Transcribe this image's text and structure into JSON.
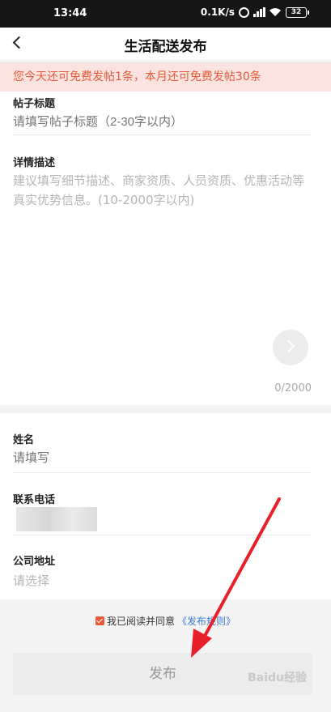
{
  "status": {
    "time": "13:44",
    "speed": "0.1K/s",
    "battery": "32"
  },
  "header": {
    "title": "生活配送发布"
  },
  "notice": "您今天还可免费发帖1条，本月还可免费发帖30条",
  "form": {
    "post_title": {
      "label": "帖子标题",
      "placeholder": "请填写帖子标题（2-30字以内）"
    },
    "description": {
      "label": "详情描述",
      "placeholder": "建议填写细节描述、商家资质、人员资质、优惠活动等真实优势信息。(10-2000字以内)",
      "counter": "0/2000"
    },
    "name": {
      "label": "姓名",
      "placeholder": "请填写"
    },
    "phone": {
      "label": "联系电话"
    },
    "address": {
      "label": "公司地址",
      "placeholder": "请选择"
    }
  },
  "agreement": {
    "text": "我已阅读并同意",
    "link": "《发布规则》",
    "checked": true
  },
  "publish_label": "发布",
  "watermark": "Baidu经验",
  "colors": {
    "accent": "#e9583a",
    "notice_bg": "#fbe4df",
    "link": "#3a7bd5",
    "arrow": "#e8202a"
  }
}
